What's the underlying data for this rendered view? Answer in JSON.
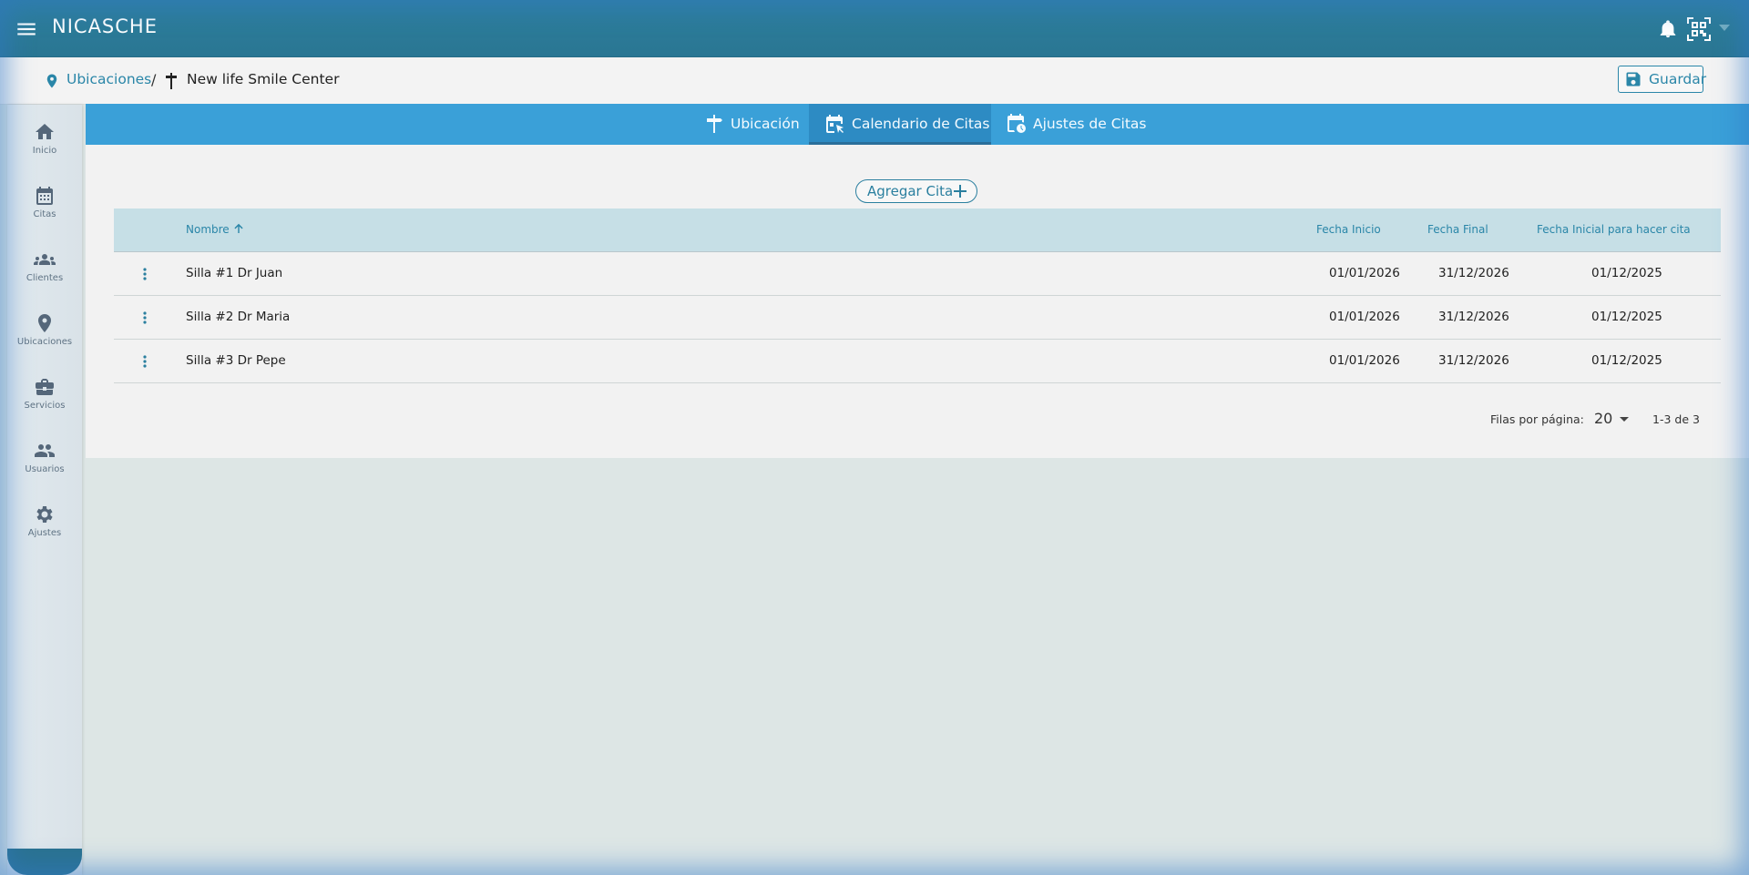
{
  "app": {
    "title": "NICASCHE"
  },
  "topbar": {
    "icons": [
      "menu-icon",
      "bell-icon",
      "qr-scan-icon",
      "chevron-down-icon"
    ]
  },
  "breadcrumb": {
    "parent": "Ubicaciones",
    "separator": "/",
    "current": "New life Smile Center"
  },
  "toolbar": {
    "save_label": "Guardar"
  },
  "sidebar": {
    "items": [
      {
        "label": "Inicio",
        "icon": "home-icon"
      },
      {
        "label": "Citas",
        "icon": "calendar-icon"
      },
      {
        "label": "Clientes",
        "icon": "people-icon"
      },
      {
        "label": "Ubicaciones",
        "icon": "location-pin-icon"
      },
      {
        "label": "Servicios",
        "icon": "briefcase-icon"
      },
      {
        "label": "Usuarios",
        "icon": "users-icon"
      },
      {
        "label": "Ajustes",
        "icon": "gear-icon"
      }
    ]
  },
  "tabs": [
    {
      "label": "Ubicación",
      "icon": "signpost-icon",
      "active": false
    },
    {
      "label": "Calendario de Citas",
      "icon": "calendar-cursor-icon",
      "active": true
    },
    {
      "label": "Ajustes de Citas",
      "icon": "calendar-clock-icon",
      "active": false
    }
  ],
  "add_button": {
    "label": "Agregar Cita"
  },
  "table": {
    "columns": [
      "Nombre",
      "Fecha Inicio",
      "Fecha Final",
      "Fecha Inicial para hacer cita"
    ],
    "sorted_by": "Nombre",
    "rows": [
      {
        "nombre": "Silla #1 Dr Juan",
        "fecha_inicio": "01/01/2026",
        "fecha_final": "31/12/2026",
        "fecha_inicial_cita": "01/12/2025"
      },
      {
        "nombre": "Silla #2 Dr Maria",
        "fecha_inicio": "01/01/2026",
        "fecha_final": "31/12/2026",
        "fecha_inicial_cita": "01/12/2025"
      },
      {
        "nombre": "Silla #3 Dr Pepe",
        "fecha_inicio": "01/01/2026",
        "fecha_final": "31/12/2026",
        "fecha_inicial_cita": "01/12/2025"
      }
    ]
  },
  "pagination": {
    "rows_per_page_label": "Filas por página:",
    "rows_per_page": "20",
    "range": "1-3 de 3"
  },
  "colors": {
    "topbar": "#2d7f9c",
    "tabs": "#3aa0d8",
    "accent": "#2a86a8",
    "table_header": "#c6dfe6"
  }
}
